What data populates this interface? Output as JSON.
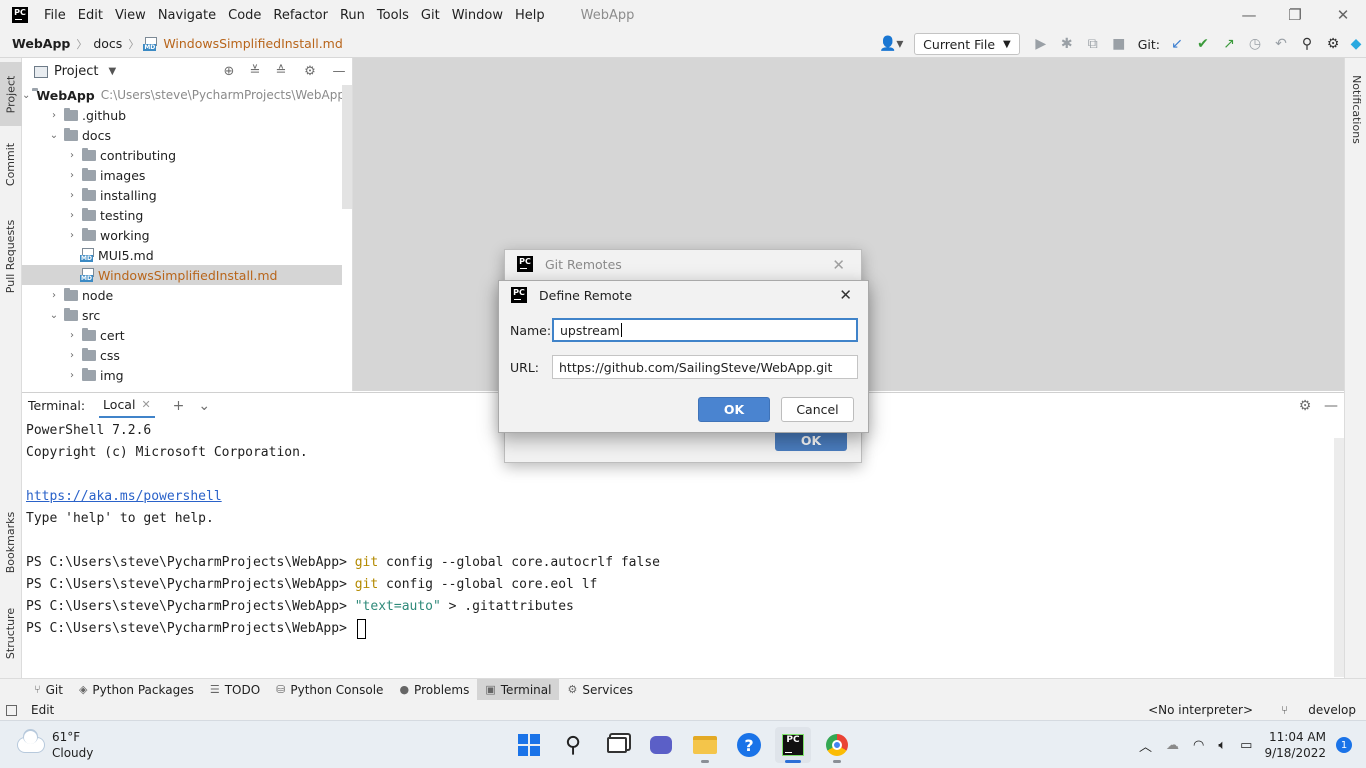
{
  "titlebar": {
    "menus": [
      "File",
      "Edit",
      "View",
      "Navigate",
      "Code",
      "Refactor",
      "Run",
      "Tools",
      "Git",
      "Window",
      "Help"
    ],
    "app_title": "WebApp"
  },
  "navbar": {
    "crumbs": [
      "WebApp",
      "docs",
      "WindowsSimplifiedInstall.md"
    ],
    "run_config": "Current File",
    "git_label": "Git:"
  },
  "left_stripe": {
    "project": "Project",
    "commit": "Commit",
    "pull_requests": "Pull Requests",
    "bookmarks": "Bookmarks",
    "structure": "Structure"
  },
  "right_stripe": {
    "notifications": "Notifications"
  },
  "project_panel": {
    "title": "Project",
    "tree": [
      {
        "name": "WebApp",
        "path": "C:\\Users\\steve\\PycharmProjects\\WebApp",
        "level": 0,
        "kind": "project-folder",
        "expanded": true
      },
      {
        "name": ".github",
        "level": 1,
        "kind": "folder",
        "expanded": false
      },
      {
        "name": "docs",
        "level": 1,
        "kind": "folder",
        "expanded": true
      },
      {
        "name": "contributing",
        "level": 2,
        "kind": "folder",
        "expanded": false
      },
      {
        "name": "images",
        "level": 2,
        "kind": "folder",
        "expanded": false
      },
      {
        "name": "installing",
        "level": 2,
        "kind": "folder",
        "expanded": false
      },
      {
        "name": "testing",
        "level": 2,
        "kind": "folder",
        "expanded": false
      },
      {
        "name": "working",
        "level": 2,
        "kind": "folder",
        "expanded": false
      },
      {
        "name": "MUI5.md",
        "level": 2,
        "kind": "md-file"
      },
      {
        "name": "WindowsSimplifiedInstall.md",
        "level": 2,
        "kind": "md-file",
        "selected": true,
        "modified": true
      },
      {
        "name": "node",
        "level": 1,
        "kind": "folder",
        "expanded": false
      },
      {
        "name": "src",
        "level": 1,
        "kind": "folder",
        "expanded": true
      },
      {
        "name": "cert",
        "level": 2,
        "kind": "folder",
        "expanded": false
      },
      {
        "name": "css",
        "level": 2,
        "kind": "folder",
        "expanded": false
      },
      {
        "name": "img",
        "level": 2,
        "kind": "folder",
        "expanded": false
      }
    ]
  },
  "terminal": {
    "label": "Terminal:",
    "tab": "Local",
    "lines": [
      {
        "text": "PowerShell 7.2.6"
      },
      {
        "text": "Copyright (c) Microsoft Corporation."
      },
      {
        "text": ""
      },
      {
        "link": "https://aka.ms/powershell"
      },
      {
        "text": "Type 'help' to get help."
      },
      {
        "text": ""
      },
      {
        "prompt": "PS C:\\Users\\steve\\PycharmProjects\\WebApp> ",
        "cmd": "git",
        "rest": " config --global core.autocrlf false"
      },
      {
        "prompt": "PS C:\\Users\\steve\\PycharmProjects\\WebApp> ",
        "cmd": "git",
        "rest": " config --global core.eol lf"
      },
      {
        "prompt": "PS C:\\Users\\steve\\PycharmProjects\\WebApp> ",
        "str": "\"text=auto\"",
        "rest": " > .gitattributes"
      },
      {
        "prompt": "PS C:\\Users\\steve\\PycharmProjects\\WebApp> ",
        "cursor": true
      }
    ]
  },
  "tool_tabs": [
    {
      "label": "Git",
      "icon": "branch-icon"
    },
    {
      "label": "Python Packages",
      "icon": "packages-icon"
    },
    {
      "label": "TODO",
      "icon": "list-icon"
    },
    {
      "label": "Python Console",
      "icon": "python-console-icon"
    },
    {
      "label": "Problems",
      "icon": "problems-icon"
    },
    {
      "label": "Terminal",
      "icon": "terminal-icon",
      "active": true
    },
    {
      "label": "Services",
      "icon": "services-icon"
    }
  ],
  "statusbar": {
    "mode": "Edit",
    "interpreter": "<No interpreter>",
    "branch": "develop"
  },
  "taskbar": {
    "weather_temp": "61°F",
    "weather_desc": "Cloudy",
    "time": "11:04 AM",
    "date": "9/18/2022",
    "notification_count": "1"
  },
  "git_remotes_dialog": {
    "title": "Git Remotes",
    "ok_label": "OK"
  },
  "define_remote_dialog": {
    "title": "Define Remote",
    "name_label": "Name:",
    "name_value": "upstream",
    "url_label": "URL:",
    "url_value": "https://github.com/SailingSteve/WebApp.git",
    "ok_label": "OK",
    "cancel_label": "Cancel"
  }
}
